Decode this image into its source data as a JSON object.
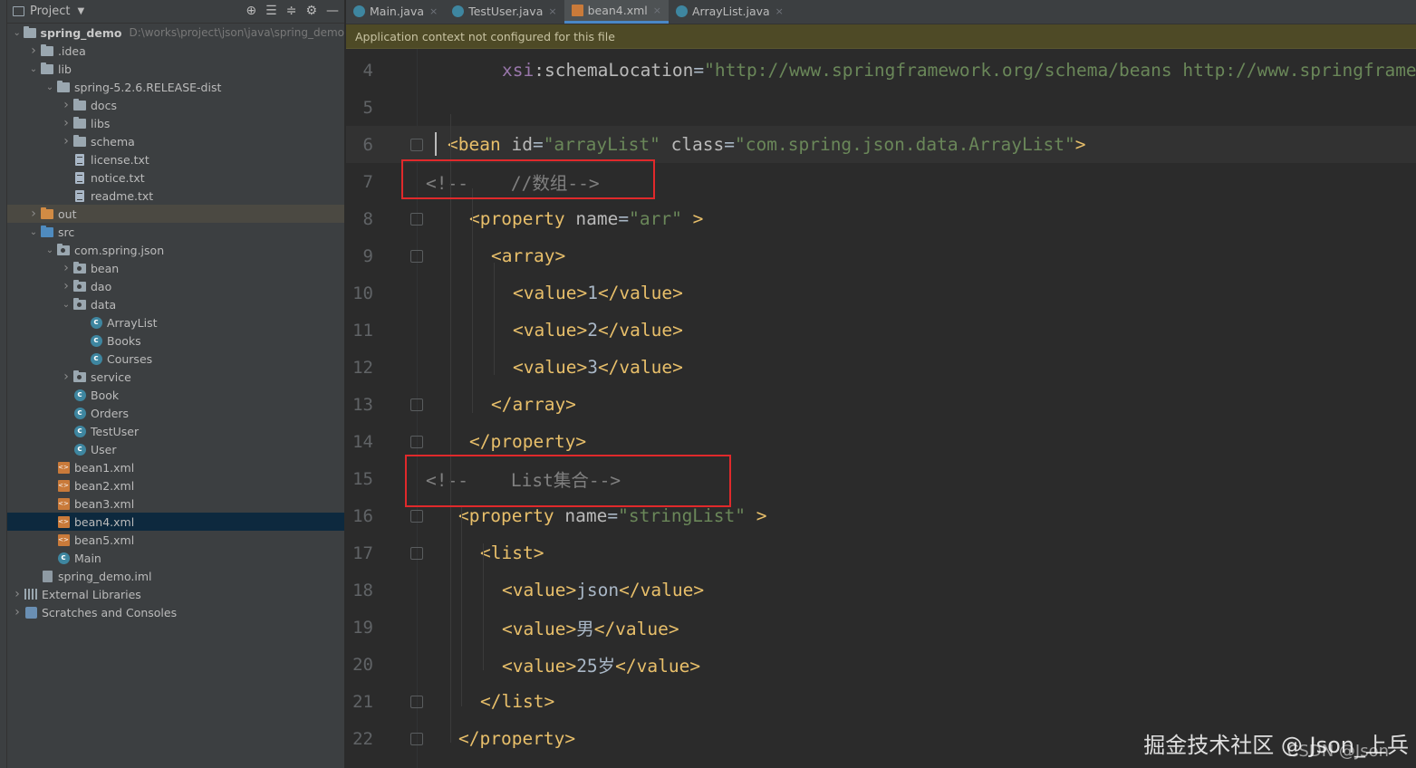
{
  "project_panel": {
    "title": "Project",
    "tree": [
      {
        "label": "spring_demo",
        "path": "D:\\works\\project\\json\\java\\spring_demo",
        "depth": 0,
        "arrow": "open",
        "icon": "folder-icon",
        "kind": "folder",
        "bold": true
      },
      {
        "label": ".idea",
        "depth": 1,
        "arrow": "closed",
        "icon": "folder-icon",
        "kind": "folder"
      },
      {
        "label": "lib",
        "depth": 1,
        "arrow": "open",
        "icon": "folder-icon",
        "kind": "folder"
      },
      {
        "label": "spring-5.2.6.RELEASE-dist",
        "depth": 2,
        "arrow": "open",
        "icon": "folder-icon",
        "kind": "folder"
      },
      {
        "label": "docs",
        "depth": 3,
        "arrow": "closed",
        "icon": "folder-icon",
        "kind": "folder"
      },
      {
        "label": "libs",
        "depth": 3,
        "arrow": "closed",
        "icon": "folder-icon",
        "kind": "folder"
      },
      {
        "label": "schema",
        "depth": 3,
        "arrow": "closed",
        "icon": "folder-icon",
        "kind": "folder"
      },
      {
        "label": "license.txt",
        "depth": 3,
        "arrow": "none",
        "icon": "text-file-icon",
        "kind": "txt"
      },
      {
        "label": "notice.txt",
        "depth": 3,
        "arrow": "none",
        "icon": "text-file-icon",
        "kind": "txt"
      },
      {
        "label": "readme.txt",
        "depth": 3,
        "arrow": "none",
        "icon": "text-file-icon",
        "kind": "txt"
      },
      {
        "label": "out",
        "depth": 1,
        "arrow": "closed",
        "icon": "folder-icon",
        "kind": "folder-orange",
        "excluded": true
      },
      {
        "label": "src",
        "depth": 1,
        "arrow": "open",
        "icon": "source-folder-icon",
        "kind": "folder-blue"
      },
      {
        "label": "com.spring.json",
        "depth": 2,
        "arrow": "open",
        "icon": "package-icon",
        "kind": "pkg"
      },
      {
        "label": "bean",
        "depth": 3,
        "arrow": "closed",
        "icon": "package-icon",
        "kind": "pkg"
      },
      {
        "label": "dao",
        "depth": 3,
        "arrow": "closed",
        "icon": "package-icon",
        "kind": "pkg"
      },
      {
        "label": "data",
        "depth": 3,
        "arrow": "open",
        "icon": "package-icon",
        "kind": "pkg"
      },
      {
        "label": "ArrayList",
        "depth": 4,
        "arrow": "none",
        "icon": "java-class-icon",
        "kind": "class"
      },
      {
        "label": "Books",
        "depth": 4,
        "arrow": "none",
        "icon": "java-class-icon",
        "kind": "class"
      },
      {
        "label": "Courses",
        "depth": 4,
        "arrow": "none",
        "icon": "java-class-icon",
        "kind": "class"
      },
      {
        "label": "service",
        "depth": 3,
        "arrow": "closed",
        "icon": "package-icon",
        "kind": "pkg"
      },
      {
        "label": "Book",
        "depth": 3,
        "arrow": "none",
        "icon": "java-class-icon",
        "kind": "class"
      },
      {
        "label": "Orders",
        "depth": 3,
        "arrow": "none",
        "icon": "java-class-icon",
        "kind": "class"
      },
      {
        "label": "TestUser",
        "depth": 3,
        "arrow": "none",
        "icon": "java-class-icon",
        "kind": "class"
      },
      {
        "label": "User",
        "depth": 3,
        "arrow": "none",
        "icon": "java-class-icon",
        "kind": "class"
      },
      {
        "label": "bean1.xml",
        "depth": 2,
        "arrow": "none",
        "icon": "xml-file-icon",
        "kind": "xml"
      },
      {
        "label": "bean2.xml",
        "depth": 2,
        "arrow": "none",
        "icon": "xml-file-icon",
        "kind": "xml"
      },
      {
        "label": "bean3.xml",
        "depth": 2,
        "arrow": "none",
        "icon": "xml-file-icon",
        "kind": "xml"
      },
      {
        "label": "bean4.xml",
        "depth": 2,
        "arrow": "none",
        "icon": "xml-file-icon",
        "kind": "xml",
        "selected": true
      },
      {
        "label": "bean5.xml",
        "depth": 2,
        "arrow": "none",
        "icon": "xml-file-icon",
        "kind": "xml"
      },
      {
        "label": "Main",
        "depth": 2,
        "arrow": "none",
        "icon": "java-class-icon",
        "kind": "class"
      },
      {
        "label": "spring_demo.iml",
        "depth": 1,
        "arrow": "none",
        "icon": "iml-file-icon",
        "kind": "iml"
      },
      {
        "label": "External Libraries",
        "depth": 0,
        "arrow": "closed",
        "icon": "libraries-icon",
        "kind": "libs"
      },
      {
        "label": "Scratches and Consoles",
        "depth": 0,
        "arrow": "closed",
        "icon": "scratches-icon",
        "kind": "scratch"
      }
    ]
  },
  "tabs": [
    {
      "label": "Main.java",
      "kind": "java",
      "active": false
    },
    {
      "label": "TestUser.java",
      "kind": "java",
      "active": false
    },
    {
      "label": "bean4.xml",
      "kind": "xml",
      "active": true
    },
    {
      "label": "ArrayList.java",
      "kind": "java",
      "active": false
    }
  ],
  "banner": "Application context not configured for this file",
  "code_lines": [
    {
      "n": "4",
      "indent": 171,
      "tokens": [
        {
          "t": "xsi",
          "c": "ns"
        },
        {
          "t": ":schemaLocation",
          "c": "attr"
        },
        {
          "t": "=",
          "c": "plain"
        },
        {
          "t": "\"http://www.springframework.org/schema/beans http://www.springframework.org/schema/beans/spring-beans.xsd\"",
          "c": "val"
        }
      ]
    },
    {
      "n": "5",
      "indent": 0,
      "tokens": []
    },
    {
      "n": "6",
      "indent": 111,
      "current": true,
      "fold": true,
      "tokens": [
        {
          "t": "<bean ",
          "c": "tag"
        },
        {
          "t": "id",
          "c": "attr"
        },
        {
          "t": "=",
          "c": "plain"
        },
        {
          "t": "\"arrayList\"",
          "c": "val"
        },
        {
          "t": " class",
          "c": "attr"
        },
        {
          "t": "=",
          "c": "plain"
        },
        {
          "t": "\"com.spring.json.data.ArrayList\"",
          "c": "val"
        },
        {
          "t": ">",
          "c": "tag"
        }
      ]
    },
    {
      "n": "7",
      "indent": 87,
      "tokens": [
        {
          "t": "<!--    //数组-->",
          "c": "cmt"
        }
      ]
    },
    {
      "n": "8",
      "indent": 135,
      "fold": true,
      "tokens": [
        {
          "t": "<property ",
          "c": "tag"
        },
        {
          "t": "name",
          "c": "attr"
        },
        {
          "t": "=",
          "c": "plain"
        },
        {
          "t": "\"arr\"",
          "c": "val"
        },
        {
          "t": " >",
          "c": "tag"
        }
      ]
    },
    {
      "n": "9",
      "indent": 159,
      "fold": true,
      "tokens": [
        {
          "t": "<array>",
          "c": "tag"
        }
      ]
    },
    {
      "n": "10",
      "indent": 183,
      "tokens": [
        {
          "t": "<value>",
          "c": "tag"
        },
        {
          "t": "1",
          "c": "plain"
        },
        {
          "t": "</value>",
          "c": "tag"
        }
      ]
    },
    {
      "n": "11",
      "indent": 183,
      "tokens": [
        {
          "t": "<value>",
          "c": "tag"
        },
        {
          "t": "2",
          "c": "plain"
        },
        {
          "t": "</value>",
          "c": "tag"
        }
      ]
    },
    {
      "n": "12",
      "indent": 183,
      "tokens": [
        {
          "t": "<value>",
          "c": "tag"
        },
        {
          "t": "3",
          "c": "plain"
        },
        {
          "t": "</value>",
          "c": "tag"
        }
      ]
    },
    {
      "n": "13",
      "indent": 159,
      "fold": true,
      "tokens": [
        {
          "t": "</array>",
          "c": "tag"
        }
      ]
    },
    {
      "n": "14",
      "indent": 135,
      "fold": true,
      "tokens": [
        {
          "t": "</property>",
          "c": "tag"
        }
      ]
    },
    {
      "n": "15",
      "indent": 87,
      "tokens": [
        {
          "t": "<!--    List集合-->",
          "c": "cmt"
        }
      ]
    },
    {
      "n": "16",
      "indent": 123,
      "fold": true,
      "tokens": [
        {
          "t": "<property ",
          "c": "tag"
        },
        {
          "t": "name",
          "c": "attr"
        },
        {
          "t": "=",
          "c": "plain"
        },
        {
          "t": "\"stringList\"",
          "c": "val"
        },
        {
          "t": " >",
          "c": "tag"
        }
      ]
    },
    {
      "n": "17",
      "indent": 147,
      "fold": true,
      "tokens": [
        {
          "t": "<list>",
          "c": "tag"
        }
      ]
    },
    {
      "n": "18",
      "indent": 171,
      "tokens": [
        {
          "t": "<value>",
          "c": "tag"
        },
        {
          "t": "json",
          "c": "plain"
        },
        {
          "t": "</value>",
          "c": "tag"
        }
      ]
    },
    {
      "n": "19",
      "indent": 171,
      "tokens": [
        {
          "t": "<value>",
          "c": "tag"
        },
        {
          "t": "男",
          "c": "plain"
        },
        {
          "t": "</value>",
          "c": "tag"
        }
      ]
    },
    {
      "n": "20",
      "indent": 171,
      "tokens": [
        {
          "t": "<value>",
          "c": "tag"
        },
        {
          "t": "25岁",
          "c": "plain"
        },
        {
          "t": "</value>",
          "c": "tag"
        }
      ]
    },
    {
      "n": "21",
      "indent": 147,
      "fold": true,
      "tokens": [
        {
          "t": "</list>",
          "c": "tag"
        }
      ]
    },
    {
      "n": "22",
      "indent": 123,
      "fold": true,
      "tokens": [
        {
          "t": "</property>",
          "c": "tag"
        }
      ]
    }
  ],
  "watermark": "掘金技术社区 @ Json_上兵",
  "watermark_sub": "CSDN @Json",
  "colors": {
    "tag": "#e8bf6a",
    "attr": "#bababa",
    "value": "#6a8759",
    "comment": "#808080",
    "namespace": "#9876aa",
    "highlight_box": "#e0292b"
  }
}
